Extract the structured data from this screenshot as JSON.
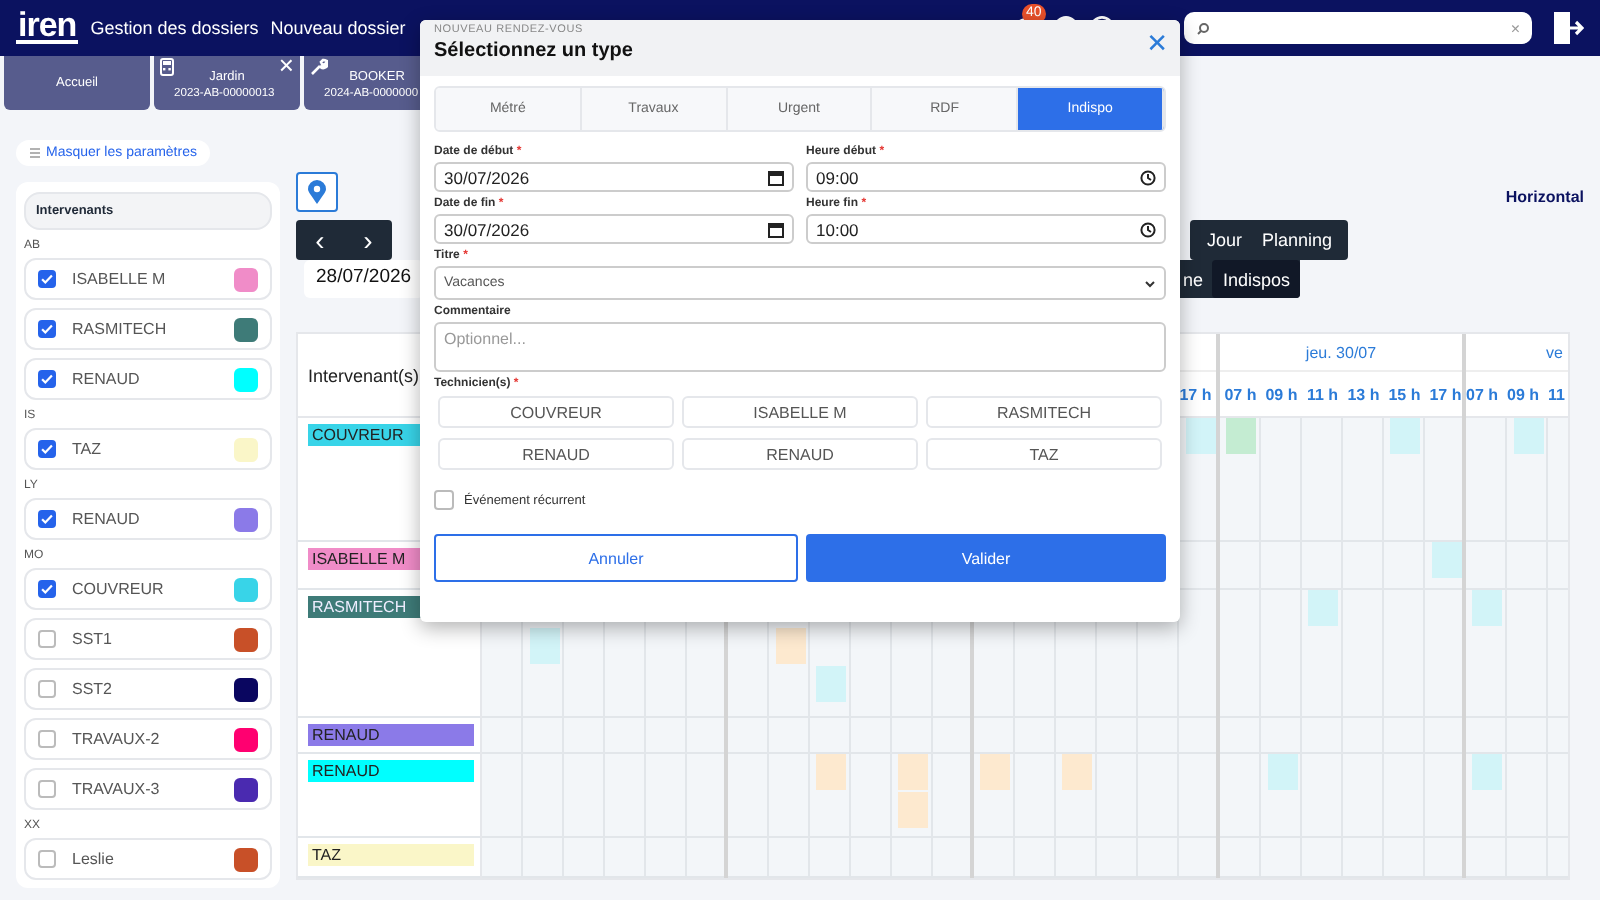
{
  "header": {
    "logo": "iren",
    "nav": [
      "Gestion des dossiers",
      "Nouveau dossier"
    ],
    "badge": "40",
    "search": {
      "clear": "×"
    }
  },
  "tabs": [
    {
      "kind": "home",
      "label": "Accueil"
    },
    {
      "kind": "calc",
      "title": "Jardin",
      "ref": "2023-AB-00000013",
      "close": "×"
    },
    {
      "kind": "tool",
      "title": "BOOKER",
      "ref": "2024-AB-0000000"
    }
  ],
  "toggle_params": "Masquer les paramètres",
  "sidebar": {
    "title": "Intervenants",
    "groups": [
      {
        "label": "AB",
        "items": [
          {
            "name": "ISABELLE M",
            "checked": true,
            "color": "#f08cc8"
          },
          {
            "name": "RASMITECH",
            "checked": true,
            "color": "#3e7b78"
          },
          {
            "name": "RENAUD",
            "checked": true,
            "color": "#00ffff"
          }
        ]
      },
      {
        "label": "IS",
        "items": [
          {
            "name": "TAZ",
            "checked": true,
            "color": "#faf6c8"
          }
        ]
      },
      {
        "label": "LY",
        "items": [
          {
            "name": "RENAUD",
            "checked": true,
            "color": "#8b7ae8"
          }
        ]
      },
      {
        "label": "MO",
        "items": [
          {
            "name": "COUVREUR",
            "checked": true,
            "color": "#38d4e8"
          },
          {
            "name": "SST1",
            "checked": false,
            "color": "#c85028"
          },
          {
            "name": "SST2",
            "checked": false,
            "color": "#0a0660"
          },
          {
            "name": "TRAVAUX-2",
            "checked": false,
            "color": "#ff0070"
          },
          {
            "name": "TRAVAUX-3",
            "checked": false,
            "color": "#4a2ab0"
          }
        ]
      },
      {
        "label": "XX",
        "items": [
          {
            "name": "Leslie",
            "checked": false,
            "color": "#c85028"
          }
        ]
      }
    ]
  },
  "planning": {
    "nav": [
      "‹",
      "›"
    ],
    "date": "28/07/2026",
    "orientation": "Horizontal",
    "views": [
      {
        "label": "Jour",
        "selected": false
      },
      {
        "label": "Planning",
        "selected": false
      }
    ],
    "filters": [
      {
        "label": "ne",
        "selected": false
      },
      {
        "label": "Indispos",
        "selected": true
      }
    ],
    "label_column": "Intervenant(s)",
    "days": [
      {
        "hours": [
          "17 h"
        ]
      },
      {
        "label": "jeu. 30/07",
        "hours": [
          "07 h",
          "09 h",
          "11 h",
          "13 h",
          "15 h",
          "17 h"
        ]
      },
      {
        "label": "ve",
        "hours": [
          "07 h",
          "09 h",
          "11"
        ]
      }
    ],
    "rows": [
      {
        "name": "COUVREUR",
        "color": "#38d4e8"
      },
      {
        "name": "ISABELLE M",
        "color": "#f08cc8"
      },
      {
        "name": "RASMITECH",
        "color": "#3e7b78"
      },
      {
        "name": "RENAUD",
        "color": "#8b7ae8"
      },
      {
        "name": "RENAUD",
        "color": "#00ffff"
      },
      {
        "name": "TAZ",
        "color": "#faf6c8"
      }
    ]
  },
  "modal": {
    "eyebrow": "NOUVEAU RENDEZ-VOUS",
    "title": "Sélectionnez un type",
    "close": "✕",
    "types": [
      {
        "label": "Métré",
        "selected": false
      },
      {
        "label": "Travaux",
        "selected": false
      },
      {
        "label": "Urgent",
        "selected": false
      },
      {
        "label": "RDF",
        "selected": false
      },
      {
        "label": "Indispo",
        "selected": true
      }
    ],
    "fields": [
      {
        "label": "Date de début",
        "required": "*",
        "value": "30/07/2026",
        "kind": "date"
      },
      {
        "label": "Heure début",
        "required": "*",
        "value": "09:00",
        "kind": "time"
      },
      {
        "label": "Date de fin",
        "required": "*",
        "value": "30/07/2026",
        "kind": "date"
      },
      {
        "label": "Heure fin",
        "required": "*",
        "value": "10:00",
        "kind": "time"
      }
    ],
    "titre": {
      "label": "Titre",
      "required": "*",
      "value": "Vacances"
    },
    "comment": {
      "label": "Commentaire",
      "placeholder": "Optionnel..."
    },
    "technicians": {
      "label": "Technicien(s)",
      "required": "*",
      "items": [
        "COUVREUR",
        "ISABELLE M",
        "RASMITECH",
        "RENAUD",
        "RENAUD",
        "TAZ"
      ]
    },
    "recurrent": {
      "label": "Événement récurrent",
      "checked": false
    },
    "cancel": "Annuler",
    "submit": "Valider"
  }
}
